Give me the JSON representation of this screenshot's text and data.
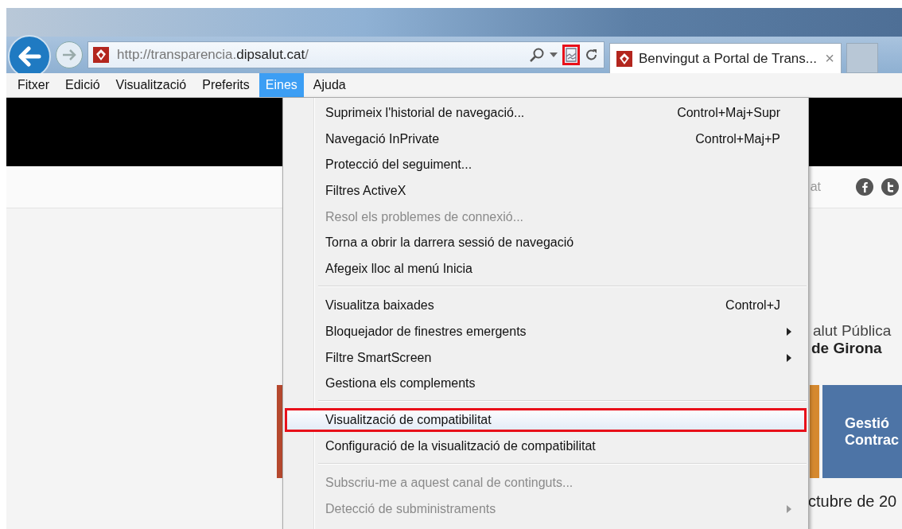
{
  "address_bar": {
    "url_prefix": "http://transparencia.",
    "url_domain": "dipsalut.cat",
    "url_suffix": "/",
    "compat_icon_marked": true
  },
  "tab": {
    "title": "Benvingut a Portal de Trans...",
    "close": "×",
    "selected": true
  },
  "menu_bar": [
    {
      "label": "Fitxer",
      "selected": false
    },
    {
      "label": "Edició",
      "selected": false
    },
    {
      "label": "Visualització",
      "selected": false
    },
    {
      "label": "Preferits",
      "selected": false
    },
    {
      "label": "Eines",
      "selected": true
    },
    {
      "label": "Ajuda",
      "selected": false
    }
  ],
  "page": {
    "header_text": "at",
    "org_line_1": "alut Pública",
    "org_line_2": "de Girona",
    "tile_line_1": "Gestió",
    "tile_line_2": "Contrac",
    "date_text": "ctubre de 20"
  },
  "menu": [
    {
      "kind": "item",
      "label": "Suprimeix l'historial de navegació...",
      "shortcut": "Control+Maj+Supr",
      "submenu": false,
      "disabled": false,
      "selected": false
    },
    {
      "kind": "item",
      "label": "Navegació InPrivate",
      "shortcut": "Control+Maj+P",
      "submenu": false,
      "disabled": false,
      "selected": false
    },
    {
      "kind": "item",
      "label": "Protecció del seguiment...",
      "submenu": false,
      "disabled": false,
      "selected": false
    },
    {
      "kind": "item",
      "label": "Filtres ActiveX",
      "submenu": false,
      "disabled": false,
      "selected": false
    },
    {
      "kind": "item",
      "label": "Resol els problemes de connexió...",
      "submenu": false,
      "disabled": true,
      "selected": false
    },
    {
      "kind": "item",
      "label": "Torna a obrir la darrera sessió de navegació",
      "submenu": false,
      "disabled": false,
      "selected": false
    },
    {
      "kind": "item",
      "label": "Afegeix lloc al menú Inicia",
      "submenu": false,
      "disabled": false,
      "selected": false
    },
    {
      "kind": "separator"
    },
    {
      "kind": "item",
      "label": "Visualitza baixades",
      "shortcut": "Control+J",
      "submenu": false,
      "disabled": false,
      "selected": false
    },
    {
      "kind": "item",
      "label": "Bloquejador de finestres emergents",
      "submenu": true,
      "disabled": false,
      "selected": false
    },
    {
      "kind": "item",
      "label": "Filtre SmartScreen",
      "submenu": true,
      "disabled": false,
      "selected": false
    },
    {
      "kind": "item",
      "label": "Gestiona els complements",
      "submenu": false,
      "disabled": false,
      "selected": false
    },
    {
      "kind": "separator"
    },
    {
      "kind": "item",
      "label": "Visualització de compatibilitat",
      "submenu": false,
      "disabled": false,
      "selected": true
    },
    {
      "kind": "item",
      "label": "Configuració de la visualització de compatibilitat",
      "submenu": false,
      "disabled": false,
      "selected": false
    },
    {
      "kind": "separator"
    },
    {
      "kind": "item",
      "label": "Subscriu-me a aquest canal de continguts...",
      "submenu": false,
      "disabled": true,
      "selected": false
    },
    {
      "kind": "item",
      "label": "Detecció de subministraments",
      "submenu": true,
      "disabled": true,
      "selected": false
    }
  ]
}
